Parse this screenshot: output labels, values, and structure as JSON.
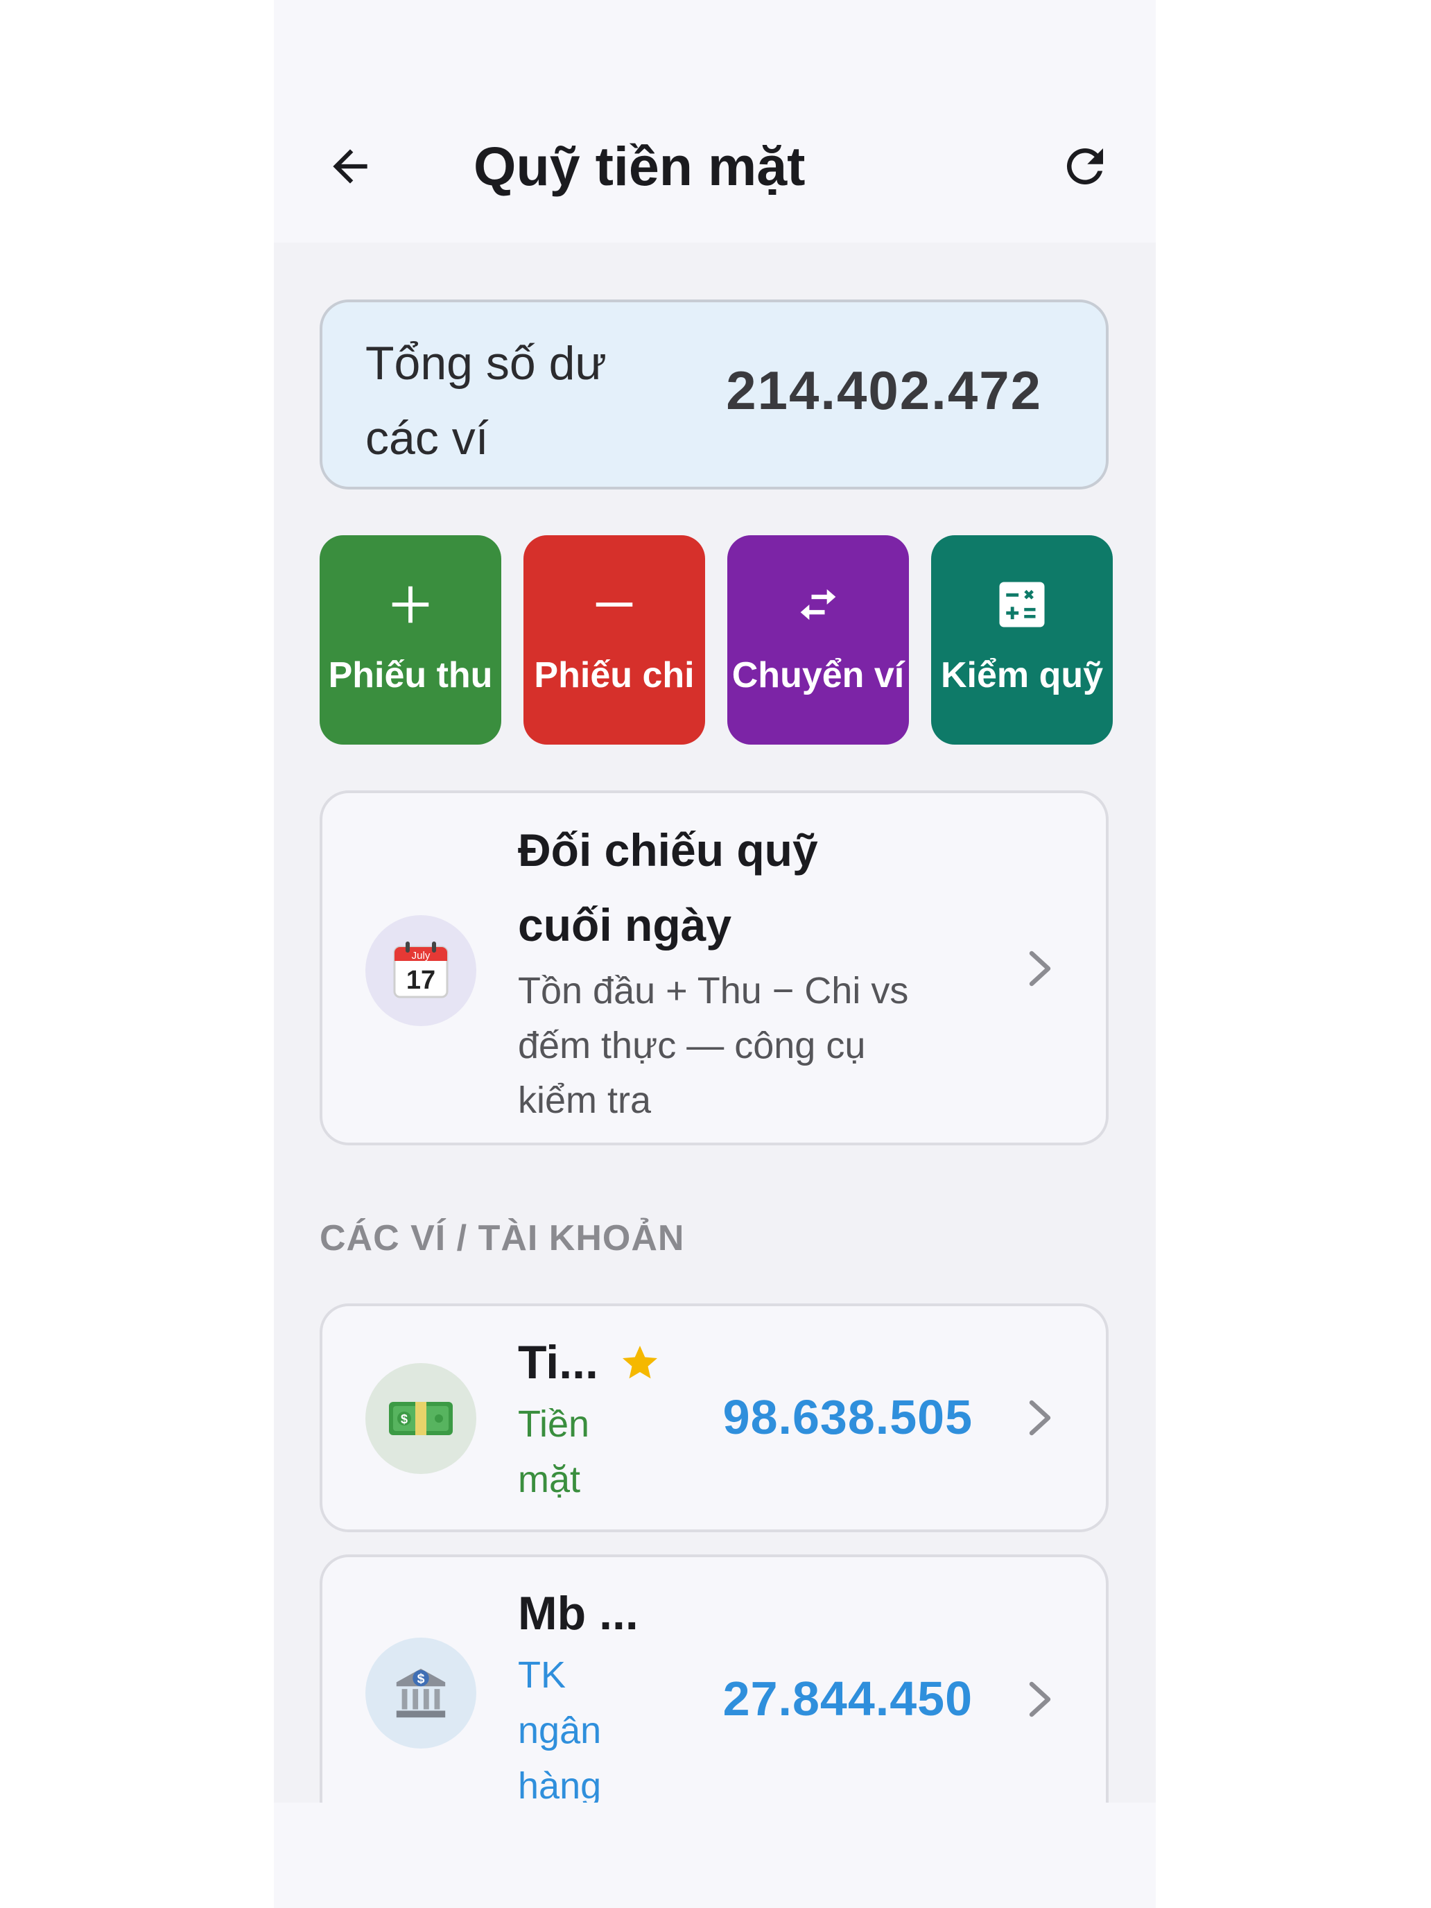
{
  "header": {
    "title": "Quỹ tiền mặt",
    "back_icon": "arrow-left-icon",
    "refresh_icon": "refresh-icon"
  },
  "balance": {
    "label": "Tổng số dư các ví",
    "value": "214.402.472"
  },
  "actions": [
    {
      "label": "Phiếu thu",
      "icon": "plus-icon",
      "color": "#3a8e3e"
    },
    {
      "label": "Phiếu chi",
      "icon": "minus-icon",
      "color": "#d6302b"
    },
    {
      "label": "Chuyển ví",
      "icon": "swap-arrows-icon",
      "color": "#7c24a6"
    },
    {
      "label": "Kiểm quỹ",
      "icon": "calculator-icon",
      "color": "#0e7a68"
    }
  ],
  "reconcile": {
    "title": "Đối chiếu quỹ cuối ngày",
    "subtitle": "Tồn đầu + Thu − Chi vs đếm thực — công cụ kiểm tra",
    "calendar_month": "July",
    "calendar_day": "17"
  },
  "section_title": "CÁC VÍ / TÀI KHOẢN",
  "wallets": [
    {
      "name": "Ti...",
      "type": "Tiền mặt",
      "balance": "98.638.505",
      "icon": "cash-banknote-icon",
      "type_color": "#3a8e3e",
      "starred": true
    },
    {
      "name": "Mb ...",
      "type": "TK ngân hàng",
      "balance": "27.844.450",
      "icon": "bank-icon",
      "type_color": "#2f8fdc",
      "starred": false
    }
  ],
  "colors": {
    "accent_blue": "#2f8fdc",
    "star": "#f5b800",
    "balance_card_bg": "#e4f0fa"
  }
}
